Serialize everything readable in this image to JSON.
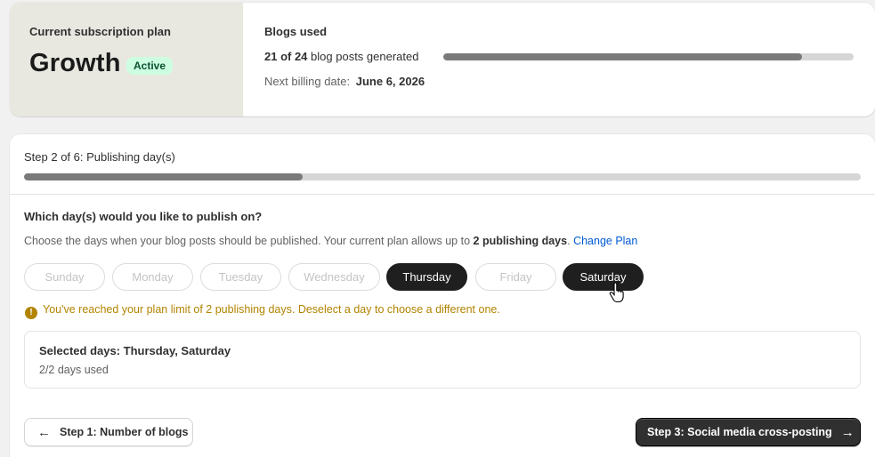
{
  "plan": {
    "label": "Current subscription plan",
    "name": "Growth",
    "status": "Active"
  },
  "usage": {
    "title": "Blogs used",
    "used_fraction": "21 of 24",
    "used_suffix": "blog posts generated",
    "used": 21,
    "total": 24,
    "billing_label": "Next billing date:",
    "billing_date": "June 6, 2026"
  },
  "step": {
    "title": "Step 2 of 6: Publishing day(s)",
    "current": 2,
    "total": 6
  },
  "question": "Which day(s) would you like to publish on?",
  "description": {
    "text": "Choose the days when your blog posts should be published. Your current plan allows up to",
    "limit_text": "2 publishing days",
    "period": ".",
    "link": "Change Plan"
  },
  "days": [
    {
      "label": "Sunday",
      "selected": false
    },
    {
      "label": "Monday",
      "selected": false
    },
    {
      "label": "Tuesday",
      "selected": false
    },
    {
      "label": "Wednesday",
      "selected": false
    },
    {
      "label": "Thursday",
      "selected": true
    },
    {
      "label": "Friday",
      "selected": false
    },
    {
      "label": "Saturday",
      "selected": true
    }
  ],
  "warning": {
    "icon": "exclamation-icon",
    "text": "You've reached your plan limit of 2 publishing days. Deselect a day to choose a different one."
  },
  "selection": {
    "title": "Selected days: Thursday, Saturday",
    "count": "2/2 days used"
  },
  "nav": {
    "back_label": "Step 1: Number of blogs",
    "next_label": "Step 3: Social media cross-posting"
  },
  "colors": {
    "accent_link": "#005bd3",
    "warning": "#b28400",
    "badge_bg": "#cdfee1",
    "selected_day": "#1f1f1f"
  }
}
